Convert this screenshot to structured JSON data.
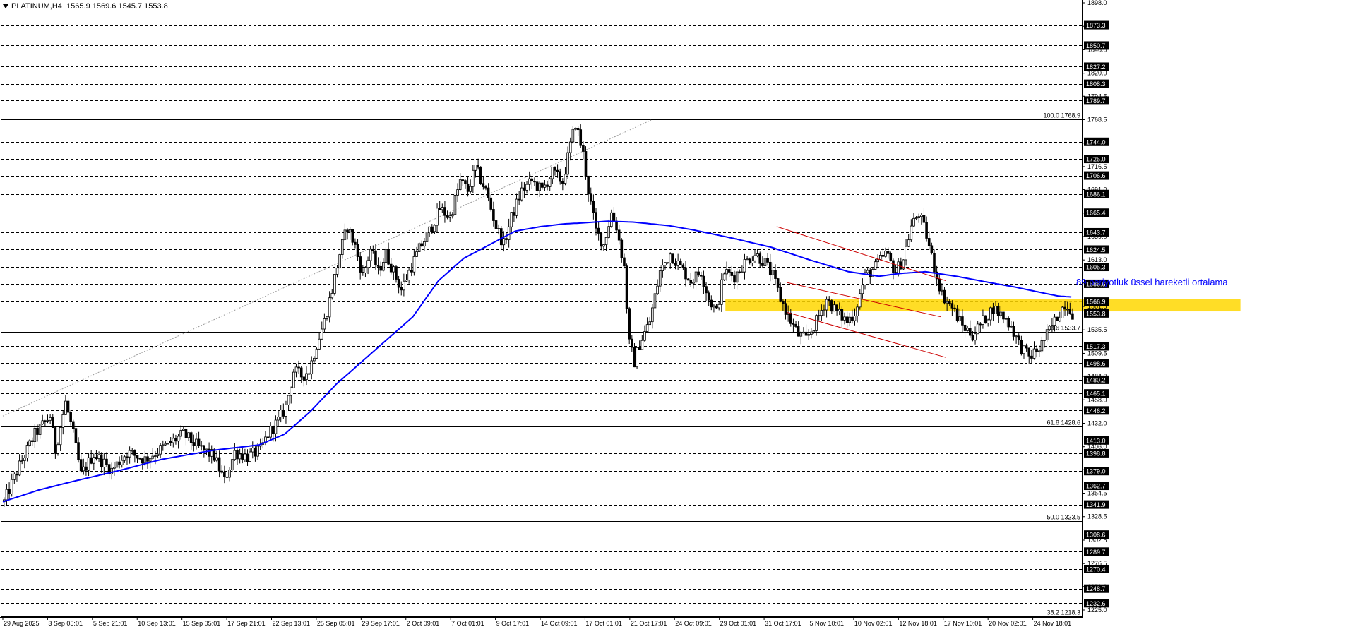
{
  "header": {
    "symbol": "PLATINUM,H4",
    "ohlc": "1565.9 1569.6 1545.7 1553.8"
  },
  "annotation": {
    "ema_label": "89 periyotluk üssel hareketli ortalama"
  },
  "colors": {
    "candle": "#000000",
    "ema": "#0000ff",
    "zone": "#ffd700",
    "channel": "#cc0000",
    "grid": "#000000",
    "fib": "#000000"
  },
  "chart_data": {
    "type": "candlestick",
    "symbol": "PLATINUM",
    "timeframe": "H4",
    "ylim": [
      1225.0,
      1898.0
    ],
    "y_ticks": [
      1898.0,
      1872.0,
      1846.0,
      1820.0,
      1794.5,
      1768.5,
      1742.5,
      1716.5,
      1691.0,
      1665.0,
      1639.0,
      1613.0,
      1587.5,
      1561.5,
      1535.5,
      1509.5,
      1484.0,
      1458.0,
      1432.0,
      1406.0,
      1380.5,
      1354.5,
      1328.5,
      1302.5,
      1276.5,
      1251.0,
      1225.0
    ],
    "x_labels": [
      "29 Aug 2025",
      "3 Sep 05:01",
      "5 Sep 21:01",
      "10 Sep 13:01",
      "15 Sep 05:01",
      "17 Sep 21:01",
      "22 Sep 13:01",
      "25 Sep 05:01",
      "29 Sep 17:01",
      "2 Oct 09:01",
      "7 Oct 01:01",
      "9 Oct 17:01",
      "14 Oct 09:01",
      "17 Oct 01:01",
      "21 Oct 17:01",
      "24 Oct 09:01",
      "29 Oct 01:01",
      "31 Oct 17:01",
      "5 Nov 10:01",
      "10 Nov 02:01",
      "12 Nov 18:01",
      "17 Nov 10:01",
      "20 Nov 02:01",
      "24 Nov 18:01"
    ],
    "horizontal_levels": [
      1873.3,
      1850.7,
      1827.2,
      1808.3,
      1789.7,
      1744.0,
      1725.0,
      1706.6,
      1686.1,
      1665.4,
      1643.7,
      1624.5,
      1605.3,
      1586.6,
      1566.9,
      1553.8,
      1517.3,
      1498.6,
      1480.2,
      1465.1,
      1446.2,
      1413.0,
      1398.8,
      1379.0,
      1362.7,
      1341.9,
      1308.6,
      1289.7,
      1270.4,
      1248.7,
      1232.6
    ],
    "fib_levels": [
      {
        "label": "100.0 1768.9",
        "value": 1768.9
      },
      {
        "label": "73.6 1533.7",
        "value": 1533.7
      },
      {
        "label": "61.8 1428.6",
        "value": 1428.6
      },
      {
        "label": "50.0 1323.5",
        "value": 1323.5
      },
      {
        "label": "38.2 1218.3",
        "value": 1218.3
      }
    ],
    "price_path": [
      [
        0,
        1345
      ],
      [
        6,
        1385
      ],
      [
        12,
        1420
      ],
      [
        18,
        1440
      ],
      [
        20,
        1402
      ],
      [
        24,
        1455
      ],
      [
        27,
        1420
      ],
      [
        30,
        1375
      ],
      [
        35,
        1398
      ],
      [
        42,
        1380
      ],
      [
        48,
        1400
      ],
      [
        55,
        1392
      ],
      [
        62,
        1405
      ],
      [
        70,
        1420
      ],
      [
        76,
        1405
      ],
      [
        82,
        1395
      ],
      [
        86,
        1368
      ],
      [
        90,
        1400
      ],
      [
        95,
        1395
      ],
      [
        100,
        1402
      ],
      [
        103,
        1420
      ],
      [
        107,
        1435
      ],
      [
        110,
        1450
      ],
      [
        113,
        1490
      ],
      [
        116,
        1485
      ],
      [
        119,
        1490
      ],
      [
        122,
        1520
      ],
      [
        125,
        1545
      ],
      [
        128,
        1580
      ],
      [
        131,
        1620
      ],
      [
        134,
        1650
      ],
      [
        137,
        1628
      ],
      [
        140,
        1595
      ],
      [
        143,
        1625
      ],
      [
        146,
        1600
      ],
      [
        149,
        1620
      ],
      [
        152,
        1600
      ],
      [
        155,
        1580
      ],
      [
        158,
        1600
      ],
      [
        162,
        1625
      ],
      [
        166,
        1645
      ],
      [
        170,
        1670
      ],
      [
        174,
        1660
      ],
      [
        178,
        1700
      ],
      [
        181,
        1690
      ],
      [
        184,
        1715
      ],
      [
        188,
        1690
      ],
      [
        192,
        1650
      ],
      [
        195,
        1630
      ],
      [
        198,
        1660
      ],
      [
        202,
        1690
      ],
      [
        206,
        1700
      ],
      [
        210,
        1690
      ],
      [
        214,
        1710
      ],
      [
        218,
        1700
      ],
      [
        221,
        1740
      ],
      [
        223,
        1765
      ],
      [
        226,
        1730
      ],
      [
        228,
        1690
      ],
      [
        231,
        1645
      ],
      [
        234,
        1630
      ],
      [
        237,
        1665
      ],
      [
        239,
        1650
      ],
      [
        242,
        1605
      ],
      [
        244,
        1520
      ],
      [
        246,
        1500
      ],
      [
        248,
        1520
      ],
      [
        252,
        1545
      ],
      [
        256,
        1600
      ],
      [
        260,
        1620
      ],
      [
        264,
        1605
      ],
      [
        268,
        1590
      ],
      [
        272,
        1600
      ],
      [
        275,
        1570
      ],
      [
        278,
        1555
      ],
      [
        281,
        1600
      ],
      [
        285,
        1595
      ],
      [
        289,
        1610
      ],
      [
        293,
        1620
      ],
      [
        297,
        1610
      ],
      [
        300,
        1595
      ],
      [
        303,
        1570
      ],
      [
        307,
        1545
      ],
      [
        310,
        1530
      ],
      [
        313,
        1525
      ],
      [
        317,
        1545
      ],
      [
        321,
        1570
      ],
      [
        325,
        1555
      ],
      [
        329,
        1545
      ],
      [
        332,
        1555
      ],
      [
        336,
        1595
      ],
      [
        340,
        1605
      ],
      [
        344,
        1620
      ],
      [
        348,
        1600
      ],
      [
        351,
        1615
      ],
      [
        354,
        1650
      ],
      [
        357,
        1665
      ],
      [
        360,
        1640
      ],
      [
        363,
        1605
      ],
      [
        366,
        1575
      ],
      [
        370,
        1560
      ],
      [
        374,
        1540
      ],
      [
        378,
        1530
      ],
      [
        382,
        1545
      ],
      [
        386,
        1560
      ],
      [
        390,
        1550
      ],
      [
        393,
        1540
      ],
      [
        396,
        1520
      ],
      [
        400,
        1505
      ],
      [
        404,
        1515
      ],
      [
        408,
        1535
      ],
      [
        412,
        1555
      ],
      [
        414,
        1565
      ],
      [
        416,
        1560
      ],
      [
        417,
        1554
      ]
    ],
    "ema_path": [
      [
        0,
        1345
      ],
      [
        14,
        1358
      ],
      [
        28,
        1368
      ],
      [
        46,
        1380
      ],
      [
        62,
        1392
      ],
      [
        82,
        1402
      ],
      [
        100,
        1408
      ],
      [
        110,
        1420
      ],
      [
        120,
        1445
      ],
      [
        130,
        1475
      ],
      [
        140,
        1500
      ],
      [
        150,
        1525
      ],
      [
        160,
        1550
      ],
      [
        170,
        1590
      ],
      [
        180,
        1615
      ],
      [
        190,
        1630
      ],
      [
        200,
        1645
      ],
      [
        210,
        1650
      ],
      [
        219,
        1653
      ],
      [
        226,
        1654
      ],
      [
        236,
        1656
      ],
      [
        246,
        1655
      ],
      [
        260,
        1651
      ],
      [
        270,
        1646
      ],
      [
        285,
        1637
      ],
      [
        300,
        1627
      ],
      [
        315,
        1613
      ],
      [
        330,
        1600
      ],
      [
        342,
        1595
      ],
      [
        350,
        1598
      ],
      [
        360,
        1600
      ],
      [
        372,
        1595
      ],
      [
        385,
        1588
      ],
      [
        395,
        1583
      ],
      [
        405,
        1577
      ],
      [
        412,
        1573
      ],
      [
        417,
        1572
      ]
    ],
    "zone": {
      "x_range": [
        282,
        483
      ],
      "y_range": [
        1556,
        1570
      ]
    },
    "channel_lines": [
      {
        "from": [
          302,
          1650
        ],
        "to": [
          368,
          1590
        ]
      },
      {
        "from": [
          306,
          1588
        ],
        "to": [
          366,
          1550
        ]
      },
      {
        "from": [
          306,
          1555
        ],
        "to": [
          368,
          1505
        ]
      }
    ],
    "dotted_trend": {
      "from": [
        0,
        1440
      ],
      "to": [
        253,
        1768
      ]
    }
  }
}
